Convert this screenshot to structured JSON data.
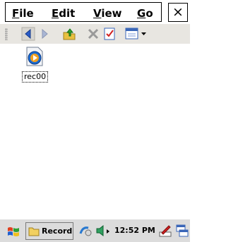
{
  "menu": {
    "file": {
      "key": "F",
      "rest": "ile"
    },
    "edit": {
      "key": "E",
      "rest": "dit"
    },
    "view": {
      "key": "V",
      "rest": "iew"
    },
    "go": {
      "key": "G",
      "rest": "o"
    }
  },
  "close_label": "×",
  "toolbar": {
    "icons": [
      "back-icon",
      "forward-icon",
      "up-folder-icon",
      "delete-icon",
      "properties-icon",
      "view-menu-icon"
    ]
  },
  "files": [
    {
      "name": "rec00",
      "icon": "media-file-icon"
    }
  ],
  "taskbar": {
    "task_label": "Record",
    "clock": "12:52 PM"
  },
  "colors": {
    "toolbar_bg": "#e8e6e1",
    "taskbar_bg": "#dcdcdc",
    "accent_blue": "#2060c0"
  }
}
